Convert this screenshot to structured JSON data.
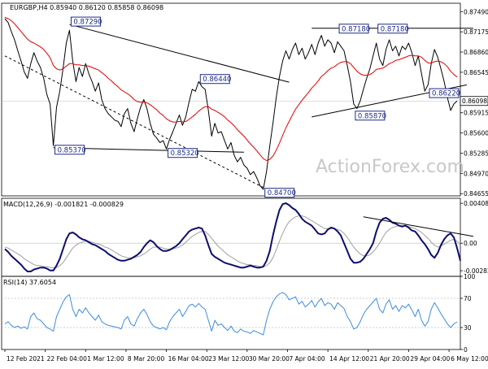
{
  "colors": {
    "price": "#000000",
    "ma": "#e60000",
    "macd": "#0d0d6e",
    "signal": "#a0a0a0",
    "rsi": "#3d8ee0",
    "trendline": "#000000",
    "label_border": "#1e2a88",
    "label_text": "#1e2a88",
    "grid": "#bdbdbd",
    "watermark": "#c8c8c8"
  },
  "chart_data": [
    {
      "type": "line",
      "panel": "price",
      "title": "EURGBP,H4  0.85940 0.86120 0.85858 0.86098",
      "watermark": "ActionForex.com",
      "ylim": [
        0.8462,
        0.8762
      ],
      "y_ticks": [
        "0.87490",
        "0.87175",
        "0.86860",
        "0.86545",
        "0.85915",
        "0.85600",
        "0.85285",
        "0.84970",
        "0.84655"
      ],
      "y_tick_values": [
        0.8749,
        0.87175,
        0.8686,
        0.86545,
        0.85915,
        0.856,
        0.85285,
        0.8497,
        0.84655
      ],
      "current_price": "0.86098",
      "current_value": 0.86098,
      "annotations": [
        {
          "text": "0.87290",
          "value": 0.8729,
          "bar": 20
        },
        {
          "text": "0.86440",
          "value": 0.8644,
          "bar": 60
        },
        {
          "text": "0.85370",
          "value": 0.8537,
          "bar": 15
        },
        {
          "text": "0.85320",
          "value": 0.8532,
          "bar": 50
        },
        {
          "text": "0.84700",
          "value": 0.847,
          "bar": 80
        },
        {
          "text": "0.87180",
          "value": 0.8718,
          "bar": 103
        },
        {
          "text": "0.87180",
          "value": 0.8718,
          "bar": 115
        },
        {
          "text": "0.85870",
          "value": 0.8587,
          "bar": 108
        },
        {
          "text": "0.86220",
          "value": 0.8622,
          "bar": 131
        }
      ],
      "series": [
        {
          "name": "EURGBP H4",
          "style": "close",
          "values": [
            0.8738,
            0.8732,
            0.8718,
            0.8705,
            0.8688,
            0.8672,
            0.8655,
            0.8645,
            0.8668,
            0.8685,
            0.8672,
            0.8662,
            0.8645,
            0.862,
            0.8605,
            0.854,
            0.86,
            0.8625,
            0.866,
            0.87,
            0.872,
            0.8672,
            0.864,
            0.8662,
            0.8648,
            0.8668,
            0.8652,
            0.864,
            0.8625,
            0.8638,
            0.8612,
            0.8598,
            0.859,
            0.8585,
            0.858,
            0.8578,
            0.857,
            0.859,
            0.8598,
            0.8575,
            0.8562,
            0.8582,
            0.86,
            0.8612,
            0.8598,
            0.8575,
            0.8558,
            0.8552,
            0.8545,
            0.8548,
            0.8535,
            0.855,
            0.8562,
            0.8575,
            0.8588,
            0.8572,
            0.8585,
            0.8608,
            0.8628,
            0.8625,
            0.864,
            0.8632,
            0.8628,
            0.8595,
            0.8555,
            0.8575,
            0.856,
            0.8562,
            0.8548,
            0.8535,
            0.8545,
            0.8525,
            0.8515,
            0.8522,
            0.851,
            0.8505,
            0.8495,
            0.85,
            0.849,
            0.8478,
            0.8472,
            0.85,
            0.854,
            0.8575,
            0.8615,
            0.8648,
            0.8672,
            0.8688,
            0.8675,
            0.869,
            0.87,
            0.8682,
            0.8692,
            0.8675,
            0.8685,
            0.8698,
            0.8682,
            0.87,
            0.8712,
            0.8695,
            0.8705,
            0.87,
            0.8685,
            0.8702,
            0.8695,
            0.8688,
            0.8665,
            0.864,
            0.8605,
            0.8598,
            0.861,
            0.8628,
            0.8645,
            0.866,
            0.868,
            0.87,
            0.8675,
            0.8665,
            0.869,
            0.8705,
            0.8688,
            0.8695,
            0.868,
            0.8695,
            0.869,
            0.87,
            0.8685,
            0.8665,
            0.868,
            0.8652,
            0.8625,
            0.8635,
            0.8668,
            0.869,
            0.8678,
            0.866,
            0.864,
            0.8615,
            0.8595,
            0.8605,
            0.861
          ]
        },
        {
          "name": "MA",
          "values": [
            0.874,
            0.8738,
            0.8735,
            0.873,
            0.8724,
            0.8718,
            0.8712,
            0.8706,
            0.8702,
            0.87,
            0.8697,
            0.8694,
            0.869,
            0.8684,
            0.8677,
            0.8665,
            0.866,
            0.8658,
            0.866,
            0.8664,
            0.8668,
            0.8668,
            0.8666,
            0.8666,
            0.8665,
            0.8665,
            0.8664,
            0.8662,
            0.866,
            0.8658,
            0.8654,
            0.865,
            0.8645,
            0.8641,
            0.8636,
            0.8632,
            0.8627,
            0.8624,
            0.8621,
            0.8617,
            0.8612,
            0.8609,
            0.8608,
            0.8608,
            0.8607,
            0.8604,
            0.86,
            0.8596,
            0.8591,
            0.8587,
            0.8582,
            0.8579,
            0.8577,
            0.8577,
            0.8578,
            0.8577,
            0.8578,
            0.8581,
            0.8585,
            0.8589,
            0.8594,
            0.8598,
            0.8601,
            0.8601,
            0.8597,
            0.8595,
            0.8592,
            0.8589,
            0.8585,
            0.858,
            0.8576,
            0.8571,
            0.8565,
            0.856,
            0.8555,
            0.8549,
            0.8543,
            0.8538,
            0.8532,
            0.8526,
            0.852,
            0.8517,
            0.8519,
            0.8524,
            0.8533,
            0.8544,
            0.8556,
            0.8568,
            0.8578,
            0.8588,
            0.8597,
            0.8604,
            0.8611,
            0.8617,
            0.8623,
            0.863,
            0.8635,
            0.8641,
            0.8648,
            0.8652,
            0.8657,
            0.8661,
            0.8663,
            0.8667,
            0.867,
            0.8671,
            0.8671,
            0.8668,
            0.8662,
            0.8656,
            0.8652,
            0.865,
            0.865,
            0.8651,
            0.8654,
            0.8659,
            0.866,
            0.8661,
            0.8664,
            0.8668,
            0.867,
            0.8673,
            0.8674,
            0.8676,
            0.8678,
            0.868,
            0.8681,
            0.868,
            0.868,
            0.8678,
            0.8673,
            0.8669,
            0.8669,
            0.8671,
            0.8672,
            0.8671,
            0.8668,
            0.8663,
            0.8656,
            0.8651,
            0.8647
          ]
        }
      ],
      "trendlines": [
        {
          "from": [
            20,
            0.8729
          ],
          "to": [
            88,
            0.8639
          ]
        },
        {
          "from": [
            15,
            0.8537
          ],
          "to": [
            74,
            0.853
          ]
        },
        {
          "from": [
            0,
            0.868
          ],
          "to": [
            82,
            0.847
          ]
        },
        {
          "from": [
            95,
            0.8723
          ],
          "to": [
            145,
            0.8723
          ]
        },
        {
          "from": [
            95,
            0.8585
          ],
          "to": [
            143,
            0.8635
          ]
        }
      ]
    },
    {
      "type": "line",
      "panel": "macd",
      "title": "MACD(12,26,9) -0.001821 -0.000829",
      "ylim": [
        -0.0034,
        0.0046
      ],
      "y_ticks": [
        "0.004088",
        "0.00",
        "-0.00282"
      ],
      "y_tick_values": [
        0.004088,
        0.0,
        -0.00282
      ],
      "trendline": {
        "from": [
          111,
          0.0027
        ],
        "to": [
          145,
          0.0007
        ]
      },
      "series": [
        {
          "name": "MACD",
          "values": [
            -0.0006,
            -0.0009,
            -0.0013,
            -0.0016,
            -0.0019,
            -0.0022,
            -0.0026,
            -0.0029,
            -0.0029,
            -0.0027,
            -0.0026,
            -0.0025,
            -0.0025,
            -0.0026,
            -0.0028,
            -0.0028,
            -0.0023,
            -0.0016,
            -0.0006,
            0.0004,
            0.001,
            0.0011,
            0.0009,
            0.0006,
            0.0004,
            0.0003,
            0.0001,
            -0.0001,
            -0.0002,
            -0.0004,
            -0.0006,
            -0.0008,
            -0.0011,
            -0.0013,
            -0.0015,
            -0.0017,
            -0.0018,
            -0.0018,
            -0.0017,
            -0.0016,
            -0.0014,
            -0.0012,
            -0.0009,
            -0.0004,
            0.0,
            0.0003,
            0.0001,
            -0.0003,
            -0.0006,
            -0.0008,
            -0.0008,
            -0.0007,
            -0.0005,
            -0.0003,
            0.0,
            0.0004,
            0.0008,
            0.0012,
            0.0014,
            0.0015,
            0.0016,
            0.0015,
            0.0008,
            -0.0002,
            -0.0011,
            -0.0014,
            -0.0016,
            -0.0018,
            -0.002,
            -0.0021,
            -0.0022,
            -0.0023,
            -0.0024,
            -0.0025,
            -0.0025,
            -0.0024,
            -0.0023,
            -0.0024,
            -0.0025,
            -0.0025,
            -0.0024,
            -0.0018,
            -0.0008,
            0.0008,
            0.0022,
            0.0034,
            0.004,
            0.0041,
            0.0039,
            0.0036,
            0.0034,
            0.003,
            0.0025,
            0.0022,
            0.002,
            0.0018,
            0.0014,
            0.001,
            0.0009,
            0.001,
            0.0014,
            0.0016,
            0.0015,
            0.0012,
            0.0008,
            0.0,
            -0.0008,
            -0.0016,
            -0.002,
            -0.002,
            -0.0019,
            -0.0016,
            -0.0011,
            -0.0006,
            0.0,
            0.0012,
            0.0021,
            0.0025,
            0.0026,
            0.0024,
            0.0021,
            0.002,
            0.0018,
            0.0017,
            0.0018,
            0.0016,
            0.0013,
            0.0012,
            0.0008,
            0.0003,
            -0.0001,
            -0.0006,
            -0.0012,
            -0.0015,
            -0.001,
            -0.0002,
            0.0004,
            0.0008,
            0.001,
            0.0006,
            -0.0005,
            -0.0018
          ]
        },
        {
          "name": "Signal",
          "values": [
            -0.0004,
            -0.0005,
            -0.0007,
            -0.0009,
            -0.0011,
            -0.0013,
            -0.0016,
            -0.0018,
            -0.002,
            -0.0022,
            -0.0023,
            -0.0023,
            -0.0024,
            -0.0024,
            -0.0025,
            -0.0025,
            -0.0025,
            -0.0023,
            -0.002,
            -0.0015,
            -0.001,
            -0.0005,
            -0.0002,
            0.0,
            0.0001,
            0.0002,
            0.0002,
            0.0001,
            0.0,
            -0.0001,
            -0.0002,
            -0.0004,
            -0.0005,
            -0.0007,
            -0.0009,
            -0.0011,
            -0.0013,
            -0.0014,
            -0.0015,
            -0.0015,
            -0.0015,
            -0.0014,
            -0.0013,
            -0.0011,
            -0.0009,
            -0.0006,
            -0.0004,
            -0.0004,
            -0.0004,
            -0.0005,
            -0.0006,
            -0.0006,
            -0.0006,
            -0.0005,
            -0.0004,
            -0.0002,
            0.0001,
            0.0004,
            0.0007,
            0.0009,
            0.0011,
            0.0012,
            0.0012,
            0.0009,
            0.0005,
            0.0001,
            -0.0003,
            -0.0006,
            -0.0009,
            -0.0012,
            -0.0014,
            -0.0016,
            -0.0018,
            -0.002,
            -0.0021,
            -0.0022,
            -0.0022,
            -0.0023,
            -0.0023,
            -0.0024,
            -0.0024,
            -0.0023,
            -0.002,
            -0.0015,
            -0.0007,
            0.0002,
            0.001,
            0.0017,
            0.0022,
            0.0025,
            0.0027,
            0.0028,
            0.0028,
            0.0027,
            0.0025,
            0.0023,
            0.0021,
            0.0019,
            0.0017,
            0.0015,
            0.0015,
            0.0015,
            0.0015,
            0.0014,
            0.0013,
            0.001,
            0.0006,
            0.0001,
            -0.0004,
            -0.0008,
            -0.0011,
            -0.0013,
            -0.0013,
            -0.0012,
            -0.0009,
            -0.0005,
            0.0,
            0.0006,
            0.0011,
            0.0014,
            0.0016,
            0.0017,
            0.0018,
            0.0018,
            0.0018,
            0.0017,
            0.0016,
            0.0015,
            0.0013,
            0.0011,
            0.0008,
            0.0005,
            0.0001,
            -0.0002,
            -0.0004,
            -0.0003,
            -0.0001,
            0.0001,
            0.0003,
            0.0004,
            0.0002,
            -0.0002
          ]
        }
      ]
    },
    {
      "type": "line",
      "panel": "rsi",
      "title": "RSI(14) 37.6054",
      "ylim": [
        0,
        100
      ],
      "y_ticks": [
        "100",
        "70",
        "30",
        "0"
      ],
      "y_tick_values": [
        100,
        70,
        30,
        0
      ],
      "levels": [
        70,
        30
      ],
      "x_tick_labels": [
        "12 Feb 2021",
        "22 Feb 04:00",
        "1 Mar 12:00",
        "8 Mar 20:00",
        "16 Mar 04:00",
        "23 Mar 12:00",
        "30 Mar 20:00",
        "7 Apr 04:00",
        "14 Apr 12:00",
        "21 Apr 20:00",
        "29 Apr 04:00",
        "6 May 12:00"
      ],
      "x_tick_bars": [
        0,
        12.5,
        25,
        37.5,
        50,
        62.5,
        75,
        87.5,
        100,
        112.5,
        125,
        137.5
      ],
      "series": [
        {
          "name": "RSI(14)",
          "values": [
            35,
            38,
            33,
            30,
            32,
            29,
            31,
            28,
            45,
            50,
            42,
            40,
            35,
            30,
            28,
            25,
            45,
            55,
            65,
            72,
            75,
            55,
            45,
            55,
            50,
            57,
            50,
            45,
            40,
            47,
            38,
            35,
            33,
            32,
            31,
            30,
            28,
            40,
            45,
            35,
            32,
            42,
            50,
            55,
            48,
            38,
            32,
            30,
            28,
            30,
            27,
            38,
            45,
            50,
            55,
            45,
            52,
            60,
            62,
            58,
            63,
            58,
            55,
            40,
            25,
            40,
            33,
            35,
            30,
            26,
            32,
            25,
            23,
            28,
            25,
            24,
            22,
            26,
            24,
            22,
            20,
            40,
            55,
            65,
            72,
            76,
            78,
            75,
            68,
            70,
            72,
            62,
            66,
            58,
            62,
            67,
            58,
            65,
            70,
            60,
            64,
            62,
            55,
            64,
            60,
            56,
            45,
            38,
            28,
            30,
            38,
            48,
            55,
            60,
            65,
            70,
            55,
            50,
            62,
            68,
            55,
            60,
            52,
            60,
            57,
            62,
            54,
            45,
            55,
            40,
            32,
            38,
            55,
            64,
            57,
            49,
            42,
            35,
            30,
            35,
            37.6
          ]
        }
      ]
    }
  ]
}
